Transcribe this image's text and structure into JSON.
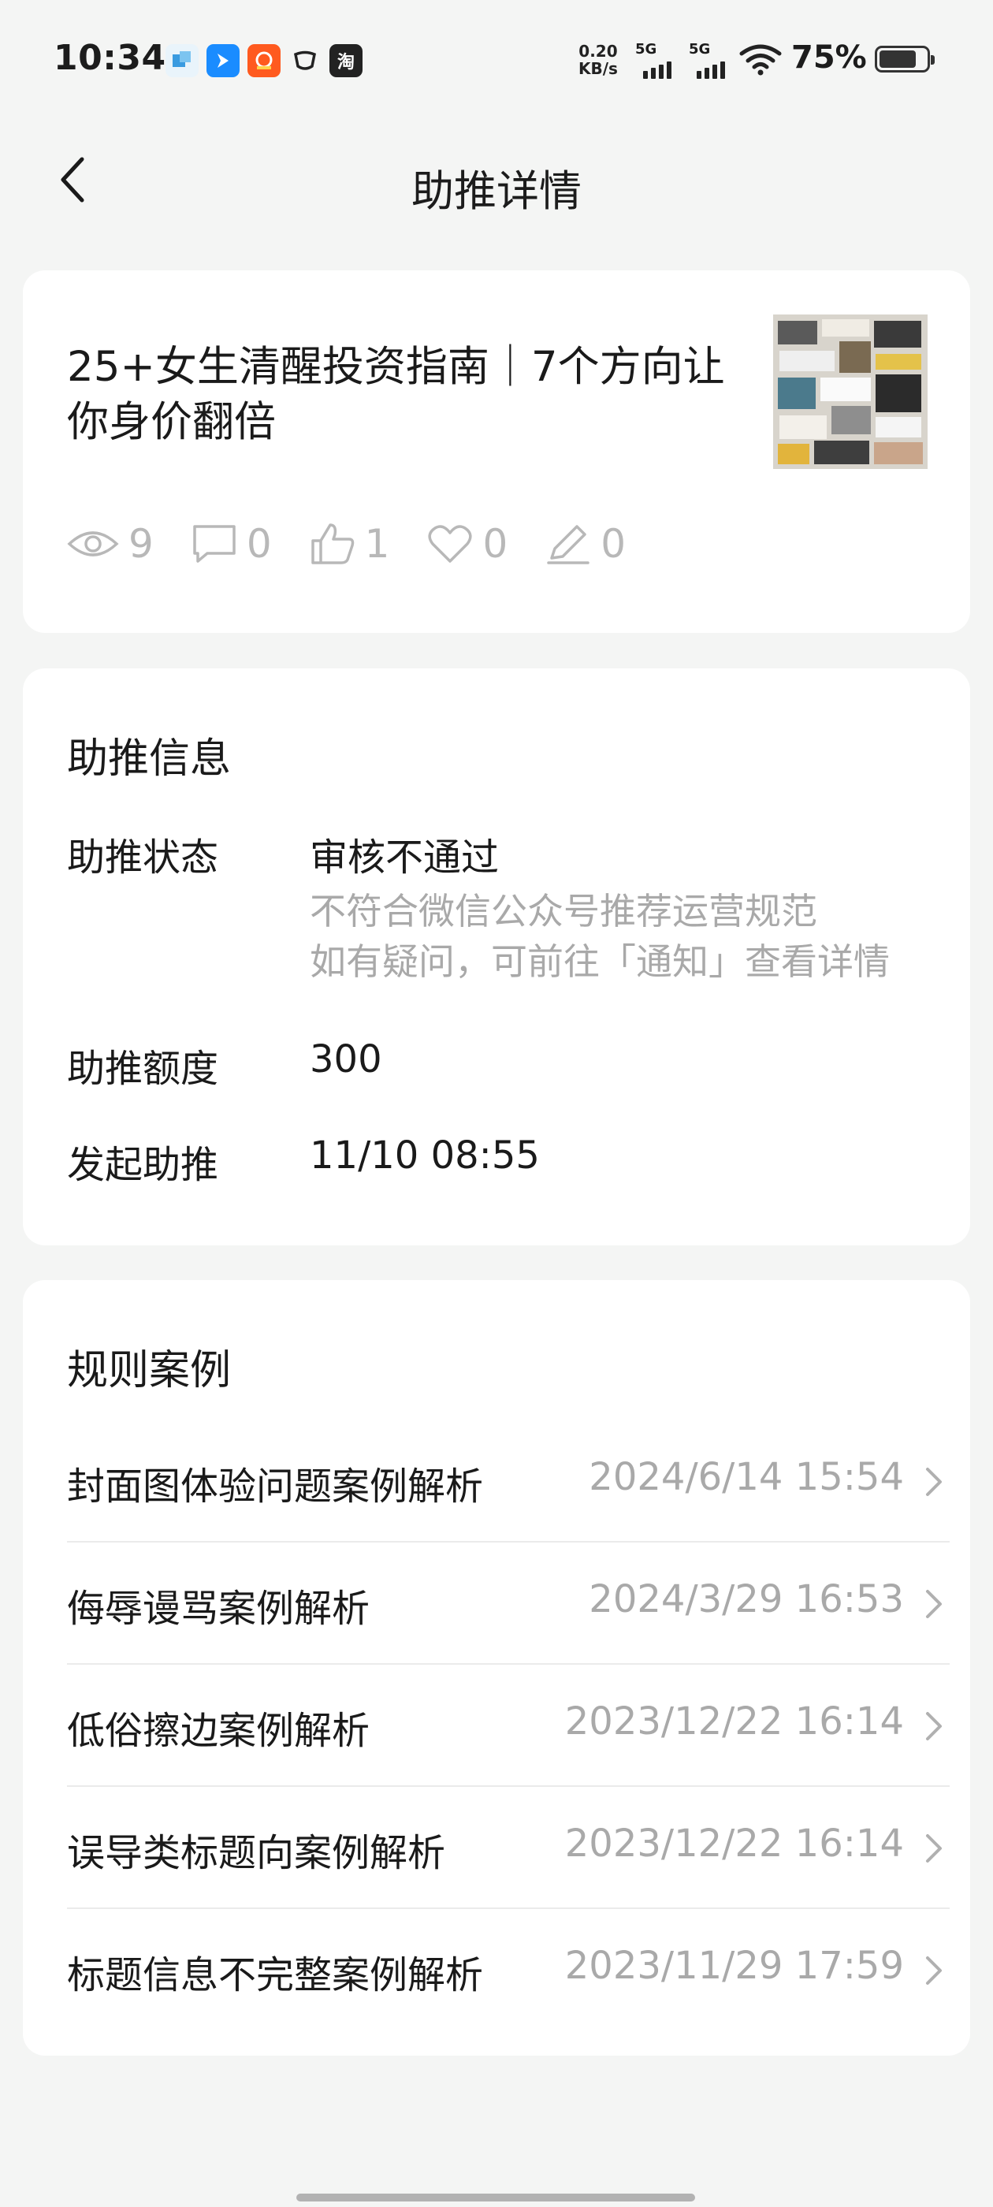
{
  "status_bar": {
    "time": "10:34",
    "net_speed_value": "0.20",
    "net_speed_unit": "KB/s",
    "signal1_tag": "5G",
    "signal2_tag": "5G",
    "battery": "75%",
    "notif_icons": [
      "app-icon-blue-square",
      "app-icon-bird",
      "app-icon-taobao-orange",
      "app-icon-cup",
      "app-icon-taobao"
    ],
    "notif_icon_taobao_label": "淘"
  },
  "nav": {
    "title": "助推详情",
    "back_icon": "chevron-left-icon"
  },
  "article": {
    "title": "25+女生清醒投资指南｜7个方向让你身价翻倍",
    "stats": {
      "views": "9",
      "comments": "0",
      "likes": "1",
      "favorites": "0",
      "edits": "0"
    }
  },
  "boost_info": {
    "section_title": "助推信息",
    "status_label": "助推状态",
    "status_value": "审核不通过",
    "status_note_line1": "不符合微信公众号推荐运营规范",
    "status_note_line2": "如有疑问，可前往「通知」查看详情",
    "quota_label": "助推额度",
    "quota_value": "300",
    "start_label": "发起助推",
    "start_value": "11/10 08:55"
  },
  "rules": {
    "section_title": "规则案例",
    "items": [
      {
        "title": "封面图体验问题案例解析",
        "date": "2024/6/14 15:54"
      },
      {
        "title": "侮辱谩骂案例解析",
        "date": "2024/3/29 16:53"
      },
      {
        "title": "低俗擦边案例解析",
        "date": "2023/12/22 16:14"
      },
      {
        "title": "误导类标题向案例解析",
        "date": "2023/12/22 16:14"
      },
      {
        "title": "标题信息不完整案例解析",
        "date": "2023/11/29 17:59"
      }
    ]
  },
  "colors": {
    "background": "#f4f5f4",
    "card": "#ffffff",
    "muted_text": "#a9a9a9",
    "primary_text": "#1a1a1a"
  }
}
